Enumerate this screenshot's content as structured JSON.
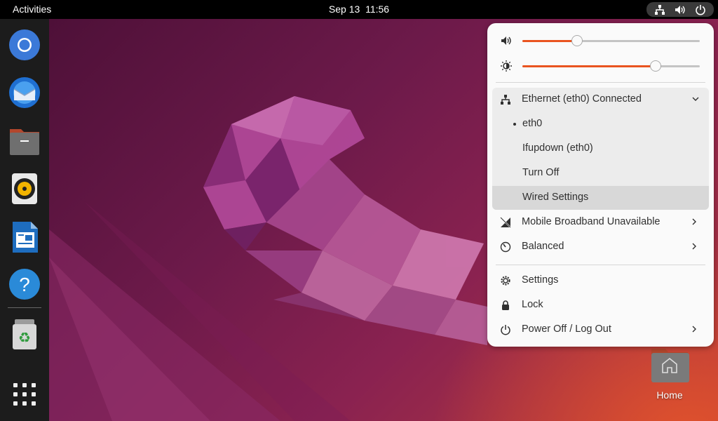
{
  "topbar": {
    "activities": "Activities",
    "date": "Sep 13",
    "time": "11:56"
  },
  "dock": {
    "apps": [
      "Chromium",
      "Thunderbird Mail",
      "Files",
      "Rhythmbox",
      "LibreOffice Writer",
      "Help",
      "Trash",
      "Show Applications"
    ]
  },
  "desktop": {
    "home_label": "Home"
  },
  "menu": {
    "volume_level": 0.31,
    "brightness_level": 0.75,
    "ethernet": {
      "label": "Ethernet (eth0) Connected",
      "items": [
        "eth0",
        "Ifupdown (eth0)",
        "Turn Off",
        "Wired Settings"
      ]
    },
    "mobile_broadband": "Mobile Broadband Unavailable",
    "power_mode": "Balanced",
    "settings": "Settings",
    "lock": "Lock",
    "power_off": "Power Off / Log Out"
  },
  "colors": {
    "accent": "#e95420",
    "menu_bg": "#fafafa",
    "topbar_bg": "#000000",
    "dock_bg": "#1c1c1c"
  }
}
